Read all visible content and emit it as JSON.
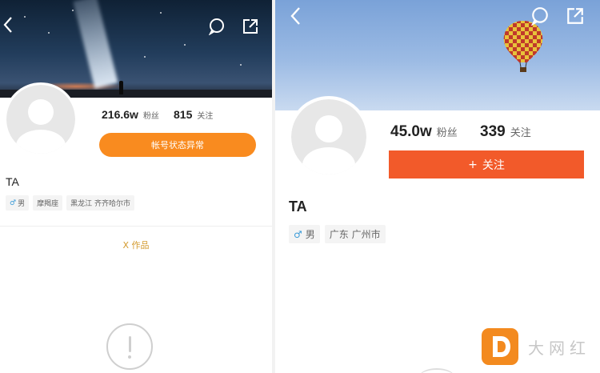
{
  "left": {
    "followers_count": "216.6w",
    "followers_label": "粉丝",
    "following_count": "815",
    "following_label": "关注",
    "status_button": "帐号状态异常",
    "name": "TA",
    "tags": [
      "男",
      "摩羯座",
      "黑龙江 齐齐哈尔市"
    ],
    "works_label": "X 作品",
    "warn_symbol": "!"
  },
  "right": {
    "followers_count": "45.0w",
    "followers_label": "粉丝",
    "following_count": "339",
    "following_label": "关注",
    "follow_button_plus": "+",
    "follow_button": "关注",
    "name": "TA",
    "tags": [
      "男",
      "广东 广州市"
    ]
  },
  "watermark": {
    "logo_letter": "D",
    "text": "大网红"
  },
  "icons": {
    "back": "back-chevron-icon",
    "chat": "chat-bubble-icon",
    "share": "share-icon",
    "male": "male-symbol-icon",
    "male_glyph": "♂"
  },
  "colors": {
    "status_button": "#f98b1f",
    "follow_button": "#f25a2a",
    "works_text": "#d39a2e",
    "male_symbol": "#3a9bd8",
    "watermark_logo": "#f38a1f"
  }
}
